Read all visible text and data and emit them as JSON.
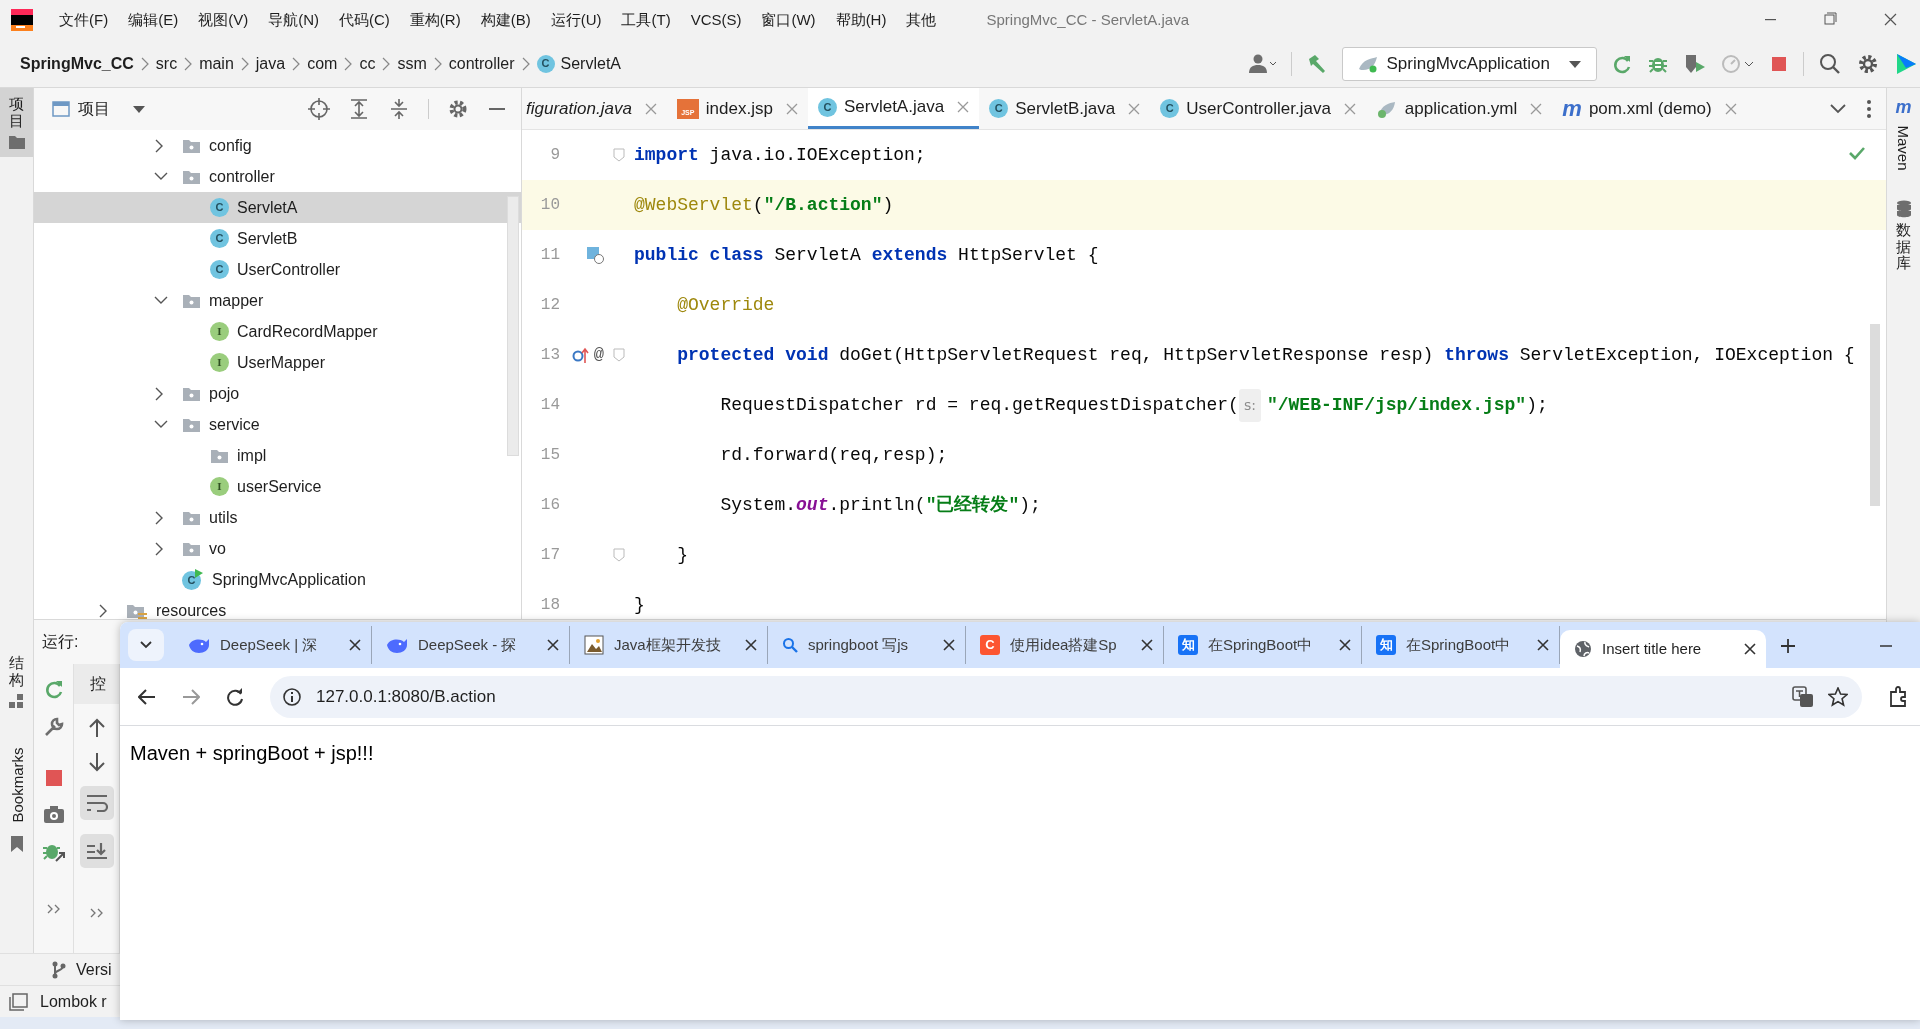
{
  "menu_bar": {
    "items": [
      "文件(F)",
      "编辑(E)",
      "视图(V)",
      "导航(N)",
      "代码(C)",
      "重构(R)",
      "构建(B)",
      "运行(U)",
      "工具(T)",
      "VCS(S)",
      "窗口(W)",
      "帮助(H)",
      "其他"
    ],
    "title": "SpringMvc_CC - ServletA.java"
  },
  "nav_bar": {
    "breadcrumbs": [
      {
        "label": "SpringMvc_CC",
        "kind": "project"
      },
      {
        "label": "src",
        "kind": "folder"
      },
      {
        "label": "main",
        "kind": "folder"
      },
      {
        "label": "java",
        "kind": "folder"
      },
      {
        "label": "com",
        "kind": "folder"
      },
      {
        "label": "cc",
        "kind": "folder"
      },
      {
        "label": "ssm",
        "kind": "folder"
      },
      {
        "label": "controller",
        "kind": "folder"
      },
      {
        "label": "ServletA",
        "kind": "class",
        "badge": "C"
      }
    ],
    "run_config": "SpringMvcApplication"
  },
  "left_strip": [
    {
      "label": "项目",
      "selected": true
    },
    {
      "label": "结构",
      "selected": false
    },
    {
      "label": "Bookmarks",
      "selected": false
    }
  ],
  "right_strip": [
    {
      "label": "Maven",
      "badge": "m"
    },
    {
      "label": "数据库"
    }
  ],
  "project_panel": {
    "title": "项目",
    "tree": [
      {
        "children": [
          {
            "children": [
              {
                "label": "config",
                "kind": "folder",
                "expanded": false,
                "selected": false
              },
              {
                "label": "controller",
                "kind": "folder",
                "expanded": true,
                "selected": false,
                "children": [
                  {
                    "label": "ServletA",
                    "kind": "class",
                    "badge": "C",
                    "selected": true
                  },
                  {
                    "label": "ServletB",
                    "kind": "class",
                    "badge": "C",
                    "selected": false
                  },
                  {
                    "label": "UserController",
                    "kind": "class",
                    "badge": "C",
                    "selected": false
                  }
                ]
              },
              {
                "label": "mapper",
                "kind": "folder",
                "expanded": true,
                "selected": false,
                "children": [
                  {
                    "label": "CardRecordMapper",
                    "kind": "interface",
                    "badge": "I",
                    "selected": false
                  },
                  {
                    "label": "UserMapper",
                    "kind": "interface",
                    "badge": "I",
                    "selected": false
                  }
                ]
              },
              {
                "label": "pojo",
                "kind": "folder",
                "expanded": false,
                "selected": false
              },
              {
                "label": "service",
                "kind": "folder",
                "expanded": true,
                "selected": false,
                "children": [
                  {
                    "label": "impl",
                    "kind": "folder",
                    "selected": false
                  },
                  {
                    "label": "userService",
                    "kind": "interface",
                    "badge": "I",
                    "selected": false
                  }
                ]
              },
              {
                "label": "utils",
                "kind": "folder",
                "expanded": false,
                "selected": false
              },
              {
                "label": "vo",
                "kind": "folder",
                "expanded": false,
                "selected": false
              },
              {
                "label": "SpringMvcApplication",
                "kind": "app",
                "badge": "C",
                "selected": false
              }
            ]
          }
        ]
      },
      {
        "label": "resources",
        "kind": "resources",
        "expanded": false,
        "selected": false
      }
    ]
  },
  "editor": {
    "tabs": [
      {
        "label": "figuration.java",
        "kind": "config",
        "selected": false
      },
      {
        "label": "index.jsp",
        "kind": "jsp",
        "badge": "JSP",
        "selected": false
      },
      {
        "label": "ServletA.java",
        "kind": "class",
        "badge": "C",
        "selected": true
      },
      {
        "label": "ServletB.java",
        "kind": "class",
        "badge": "C",
        "selected": false
      },
      {
        "label": "UserController.java",
        "kind": "class",
        "badge": "C",
        "selected": false
      },
      {
        "label": "application.yml",
        "kind": "yml",
        "selected": false
      },
      {
        "label": "pom.xml (demo)",
        "kind": "maven",
        "badge": "m",
        "selected": false
      }
    ],
    "lines": [
      {
        "number": "9",
        "current": false,
        "fold": true,
        "tokens": [
          {
            "kind": "keyword",
            "text": "import"
          },
          {
            "kind": "plain",
            "text": " java.io.IOException;"
          }
        ]
      },
      {
        "number": "10",
        "current": true,
        "tokens": [
          {
            "kind": "annotation",
            "text": "@WebServlet"
          },
          {
            "kind": "plain",
            "text": "("
          },
          {
            "kind": "string",
            "text": "\"/B.action\""
          },
          {
            "kind": "plain",
            "text": ")"
          }
        ]
      },
      {
        "number": "11",
        "current": false,
        "gutter": {
          "kind": "servlet"
        },
        "tokens": [
          {
            "kind": "keyword",
            "text": "public class"
          },
          {
            "kind": "plain",
            "text": " ServletA "
          },
          {
            "kind": "keyword",
            "text": "extends"
          },
          {
            "kind": "plain",
            "text": " HttpServlet {"
          }
        ]
      },
      {
        "number": "12",
        "current": false,
        "tokens": [
          {
            "kind": "annotation",
            "text": "    @Override"
          }
        ]
      },
      {
        "number": "13",
        "current": false,
        "gutter": {
          "kind": "override",
          "mark": "@"
        },
        "fold": true,
        "tokens": [
          {
            "kind": "keyword",
            "text": "    protected void"
          },
          {
            "kind": "plain",
            "text": " doGet(HttpServletRequest req, HttpServletResponse resp) "
          },
          {
            "kind": "keyword",
            "text": "throws"
          },
          {
            "kind": "plain",
            "text": " ServletException, IOException {"
          }
        ]
      },
      {
        "number": "14",
        "current": false,
        "tokens": [
          {
            "kind": "plain",
            "text": "        RequestDispatcher rd = req.getRequestDispatcher("
          },
          {
            "kind": "hint",
            "text": "s:"
          },
          {
            "kind": "string",
            "text": "\"/WEB-INF/jsp/index.jsp\""
          },
          {
            "kind": "plain",
            "text": ");"
          }
        ]
      },
      {
        "number": "15",
        "current": false,
        "tokens": [
          {
            "kind": "plain",
            "text": "        rd.forward(req,resp);"
          }
        ]
      },
      {
        "number": "16",
        "current": false,
        "tokens": [
          {
            "kind": "plain",
            "text": "        System."
          },
          {
            "kind": "field",
            "text": "out"
          },
          {
            "kind": "plain",
            "text": ".println("
          },
          {
            "kind": "string",
            "text": "\"已经转发\""
          },
          {
            "kind": "plain",
            "text": ");"
          }
        ]
      },
      {
        "number": "17",
        "current": false,
        "fold": true,
        "tokens": [
          {
            "kind": "plain",
            "text": "    }"
          }
        ]
      },
      {
        "number": "18",
        "current": false,
        "tokens": [
          {
            "kind": "plain",
            "text": "}"
          }
        ]
      }
    ]
  },
  "run_panel": {
    "label": "运行:",
    "tab": "控"
  },
  "bottom_tools": [
    {
      "label": "Versi",
      "kind": "vcs"
    },
    {
      "label": "Lombok r",
      "kind": "lombok"
    }
  ],
  "browser": {
    "tabs": [
      {
        "label": "DeepSeek | 深",
        "kind": "whale",
        "selected": false
      },
      {
        "label": "DeepSeek - 探",
        "kind": "whale",
        "selected": false
      },
      {
        "label": "Java框架开发技",
        "kind": "image",
        "selected": false
      },
      {
        "label": "springboot 写js",
        "kind": "search",
        "selected": false
      },
      {
        "label": "使用idea搭建Sp",
        "kind": "letter",
        "badge": "C",
        "color": "#fc5531",
        "selected": false
      },
      {
        "label": "在SpringBoot中",
        "kind": "letter",
        "badge": "知",
        "color": "#1772f6",
        "selected": false
      },
      {
        "label": "在SpringBoot中",
        "kind": "letter",
        "badge": "知",
        "color": "#1772f6",
        "selected": false
      },
      {
        "label": "Insert title here",
        "kind": "globe",
        "selected": true
      }
    ],
    "url": "127.0.0.1:8080/B.action",
    "content": "Maven + springBoot + jsp!!!"
  }
}
